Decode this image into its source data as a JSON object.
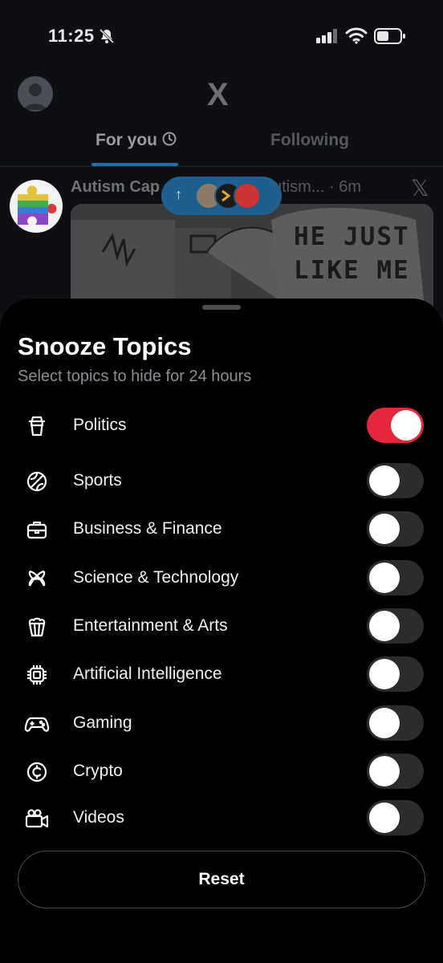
{
  "status_bar": {
    "time": "11:25",
    "icons": [
      "bell-slash-icon",
      "signal-icon",
      "wifi-icon",
      "battery-icon"
    ]
  },
  "header": {
    "logo": "X",
    "tabs": [
      {
        "label": "For you",
        "selected": true
      },
      {
        "label": "Following",
        "selected": false
      }
    ]
  },
  "post": {
    "author": "Autism Cap",
    "handle_time": "utism... · 6m",
    "comic_text_line1": "HE JUST",
    "comic_text_line2": "LIKE ME"
  },
  "sheet": {
    "title": "Snooze Topics",
    "subtitle": "Select topics to hide for 24 hours",
    "topics": [
      {
        "label": "Politics",
        "icon": "coffee-cup-icon",
        "enabled": true
      },
      {
        "label": "Sports",
        "icon": "ball-icon",
        "enabled": false
      },
      {
        "label": "Business & Finance",
        "icon": "briefcase-icon",
        "enabled": false
      },
      {
        "label": "Science & Technology",
        "icon": "atom-icon",
        "enabled": false
      },
      {
        "label": "Entertainment & Arts",
        "icon": "popcorn-icon",
        "enabled": false
      },
      {
        "label": "Artificial Intelligence",
        "icon": "chip-icon",
        "enabled": false
      },
      {
        "label": "Gaming",
        "icon": "gamepad-icon",
        "enabled": false
      },
      {
        "label": "Crypto",
        "icon": "coin-icon",
        "enabled": false
      },
      {
        "label": "Videos",
        "icon": "video-camera-icon",
        "enabled": false
      }
    ],
    "reset_label": "Reset"
  },
  "colors": {
    "toggle_on": "#e5273c",
    "toggle_off": "#2c2c2e",
    "tab_underline": "#1d6fa5"
  }
}
